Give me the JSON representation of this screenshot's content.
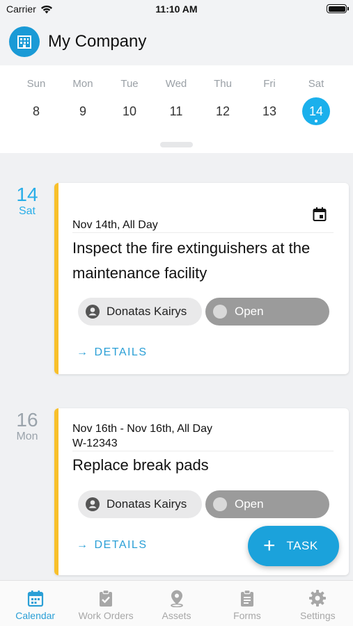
{
  "status_bar": {
    "carrier": "Carrier",
    "time": "11:10 AM"
  },
  "header": {
    "company_name": "My Company",
    "logo_icon": "building-icon"
  },
  "week": {
    "days": [
      {
        "name": "Sun",
        "num": "8"
      },
      {
        "name": "Mon",
        "num": "9"
      },
      {
        "name": "Tue",
        "num": "10"
      },
      {
        "name": "Wed",
        "num": "11"
      },
      {
        "name": "Thu",
        "num": "12"
      },
      {
        "name": "Fri",
        "num": "13"
      },
      {
        "name": "Sat",
        "num": "14"
      }
    ],
    "selected": "14"
  },
  "tasks": [
    {
      "marker_num": "14",
      "marker_day": "Sat",
      "date": "Nov 14th, All Day",
      "title": "Inspect the fire extinguishers at the maintenance facility",
      "assignee": "Donatas Kairys",
      "status": "Open",
      "details_label": "DETAILS"
    },
    {
      "marker_num": "16",
      "marker_day": "Mon",
      "date": "Nov 16th - Nov 16th, All Day",
      "id": "W-12343",
      "title": "Replace break pads",
      "assignee": "Donatas Kairys",
      "status": "Open",
      "details_label": "DETAILS"
    }
  ],
  "fab": {
    "label": "TASK"
  },
  "tab_bar": {
    "tabs": [
      {
        "label": "Calendar",
        "icon": "calendar-icon"
      },
      {
        "label": "Work Orders",
        "icon": "clipboard-check-icon"
      },
      {
        "label": "Assets",
        "icon": "map-pin-icon"
      },
      {
        "label": "Forms",
        "icon": "form-icon"
      },
      {
        "label": "Settings",
        "icon": "gear-icon"
      }
    ],
    "active": "Calendar"
  },
  "colors": {
    "accent": "#1bb0ec",
    "task_bar": "#f8c02b",
    "status_chip": "#9b9b9b",
    "link": "#2a9fd6"
  }
}
